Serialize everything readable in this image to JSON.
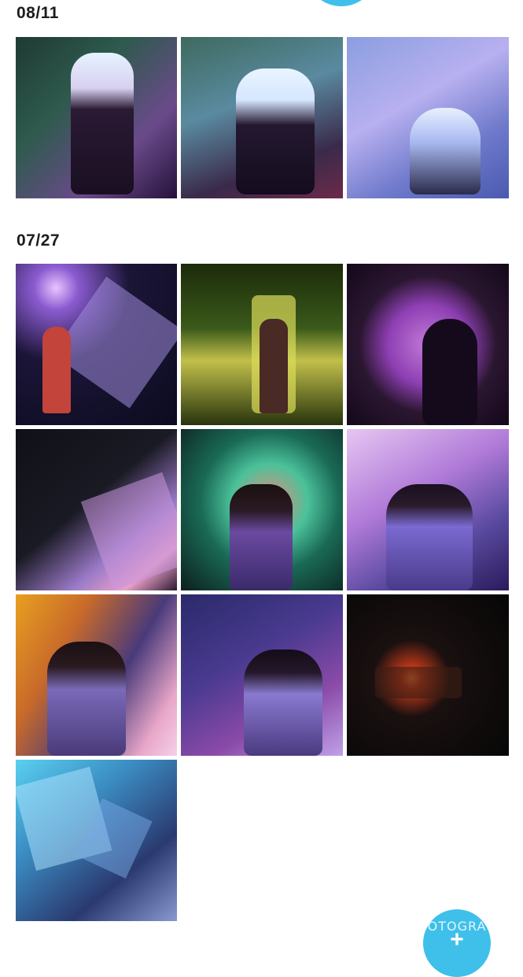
{
  "gallery": {
    "groups": [
      {
        "date": "08/11",
        "photo_count": 3
      },
      {
        "date": "07/27",
        "photo_count": 10
      }
    ]
  },
  "fab": {
    "label": "OTOGRA",
    "icon": "plus-icon",
    "color": "#3fc0ea"
  }
}
